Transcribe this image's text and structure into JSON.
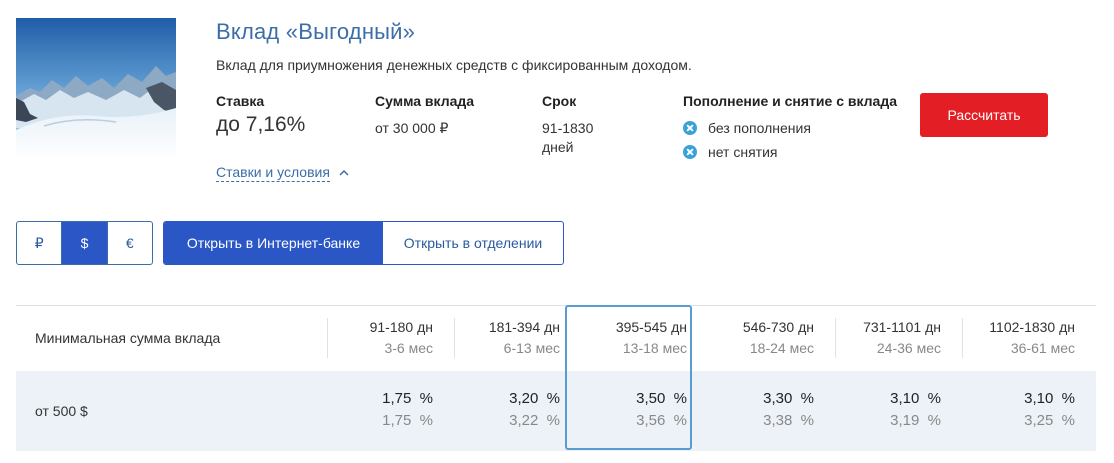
{
  "deposit": {
    "title": "Вклад «Выгодный»",
    "subtitle": "Вклад для приумножения денежных средств с фиксированным доходом.",
    "image_icon": "mountain-photo"
  },
  "params": {
    "rate": {
      "label": "Ставка",
      "value": "до 7,16%"
    },
    "sum": {
      "label": "Сумма вклада",
      "value": "от 30 000 ₽"
    },
    "term": {
      "label": "Срок",
      "value": "91-1830 дней"
    },
    "refill": {
      "label": "Пополнение и снятие с вклада",
      "items": [
        "без пополнения",
        "нет снятия"
      ],
      "icon": "x-circle-icon",
      "icon_color": "#3aa1d9"
    }
  },
  "calc_button": "Рассчитать",
  "terms_link": "Ставки и условия",
  "currencies": [
    "₽",
    "$",
    "€"
  ],
  "active_currency": "$",
  "open_options": [
    "Открыть в Интернет-банке",
    "Открыть в отделении"
  ],
  "colors": {
    "accent": "#2a56c6",
    "title": "#3b6ea8",
    "cta": "#e31e24",
    "row_bg": "#edf2f8",
    "highlight": "#5a9bd0"
  },
  "table": {
    "header_label": "Минимальная сумма вклада",
    "columns": [
      {
        "days": "91-180 дн",
        "months": "3-6 мес"
      },
      {
        "days": "181-394 дн",
        "months": "6-13 мес"
      },
      {
        "days": "395-545 дн",
        "months": "13-18 мес"
      },
      {
        "days": "546-730 дн",
        "months": "18-24 мес"
      },
      {
        "days": "731-1101 дн",
        "months": "24-36 мес"
      },
      {
        "days": "1102-1830 дн",
        "months": "36-61 мес"
      }
    ],
    "highlighted_column": 2,
    "rows": [
      {
        "label": "от 500 $",
        "rates": [
          {
            "top": "1,75  %",
            "bottom": "1,75  %"
          },
          {
            "top": "3,20  %",
            "bottom": "3,22  %"
          },
          {
            "top": "3,50  %",
            "bottom": "3,56  %"
          },
          {
            "top": "3,30  %",
            "bottom": "3,38  %"
          },
          {
            "top": "3,10  %",
            "bottom": "3,19  %"
          },
          {
            "top": "3,10  %",
            "bottom": "3,25  %"
          }
        ]
      }
    ]
  }
}
